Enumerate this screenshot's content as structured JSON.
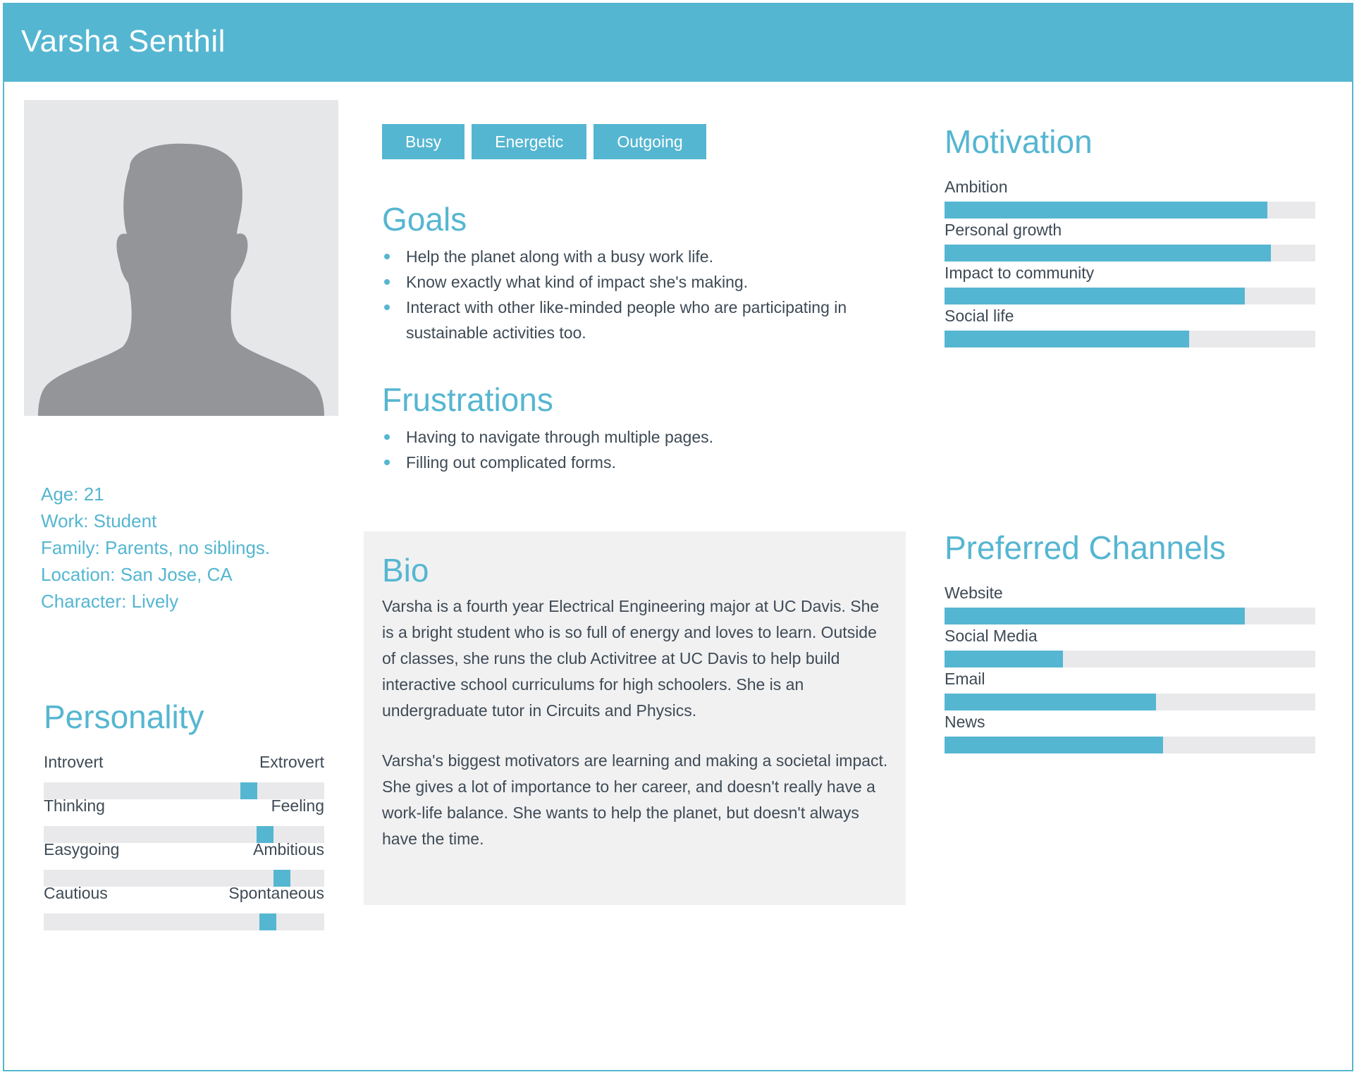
{
  "header": {
    "name": "Varsha Senthil"
  },
  "avatar": {
    "icon": "person-silhouette-icon"
  },
  "profile": [
    "Age: 21",
    "Work: Student",
    "Family: Parents, no siblings.",
    "Location: San Jose, CA",
    "Character: Lively"
  ],
  "tags": [
    "Busy",
    "Energetic",
    "Outgoing"
  ],
  "goals": {
    "title": "Goals",
    "items": [
      "Help the planet along with a busy work life.",
      "Know exactly what kind of impact she's making.",
      "Interact with other like-minded people who are participating in sustainable activities too."
    ]
  },
  "frustrations": {
    "title": "Frustrations",
    "items": [
      "Having to navigate through multiple pages.",
      "Filling out complicated forms."
    ]
  },
  "bio": {
    "title": "Bio",
    "paragraphs": [
      "Varsha is a fourth year Electrical Engineering major at UC Davis. She is a bright student who is so full of energy and loves to learn. Outside of classes, she runs the club Activitree at UC Davis to help build interactive school curriculums for high schoolers. She is an undergraduate tutor in Circuits and Physics.",
      "Varsha's biggest motivators are learning and making a societal impact. She gives a lot of importance to her career, and doesn't really have a work-life balance. She wants to help the planet, but doesn't always have the time."
    ]
  },
  "personality": {
    "title": "Personality",
    "scales": [
      {
        "left": "Introvert",
        "right": "Extrovert",
        "value": 0.73
      },
      {
        "left": "Thinking",
        "right": "Feeling",
        "value": 0.79
      },
      {
        "left": "Easygoing",
        "right": "Ambitious",
        "value": 0.85
      },
      {
        "left": "Cautious",
        "right": "Spontaneous",
        "value": 0.8
      }
    ]
  },
  "motivation": {
    "title": "Motivation",
    "items": [
      {
        "label": "Ambition",
        "value": 0.87
      },
      {
        "label": "Personal growth",
        "value": 0.88
      },
      {
        "label": "Impact to community",
        "value": 0.81
      },
      {
        "label": "Social life",
        "value": 0.66
      }
    ]
  },
  "channels": {
    "title": "Preferred Channels",
    "items": [
      {
        "label": "Website",
        "value": 0.81
      },
      {
        "label": "Social Media",
        "value": 0.32
      },
      {
        "label": "Email",
        "value": 0.57
      },
      {
        "label": "News",
        "value": 0.59
      }
    ]
  },
  "colors": {
    "accent": "#55b6d1",
    "track": "#e9e9eb",
    "text": "#3e4a55",
    "panel": "#f1f1f2"
  }
}
